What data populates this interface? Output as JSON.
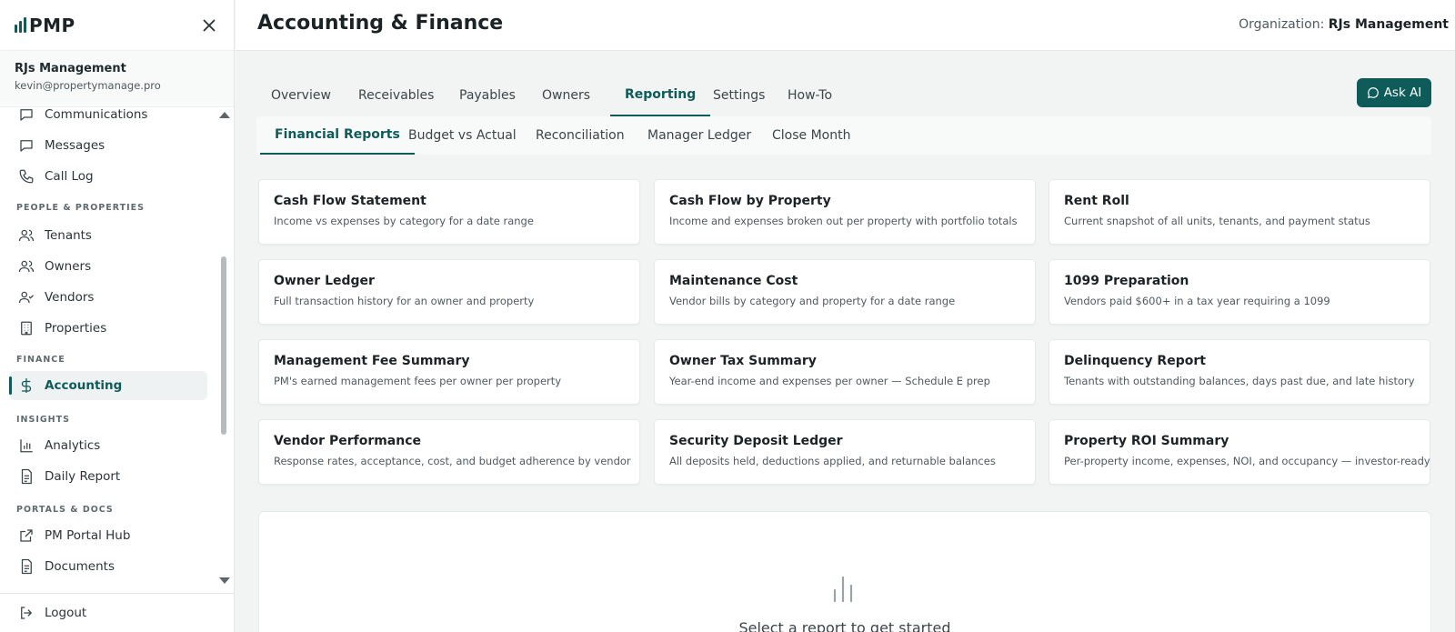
{
  "app": {
    "brand": "PMP",
    "page_title": "Accounting & Finance"
  },
  "org": {
    "label": "Organization:",
    "name": "RJs Management"
  },
  "user": {
    "name": "RJs Management",
    "email": "kevin@propertymanage.pro"
  },
  "sidebar": {
    "items": [
      {
        "label": "Communications",
        "icon": "chat-bubble-icon"
      },
      {
        "label": "Messages",
        "icon": "message-icon"
      },
      {
        "label": "Call Log",
        "icon": "phone-icon"
      },
      {
        "label": "Tenants",
        "icon": "users-icon"
      },
      {
        "label": "Owners",
        "icon": "users-icon"
      },
      {
        "label": "Vendors",
        "icon": "user-check-icon"
      },
      {
        "label": "Properties",
        "icon": "building-icon"
      },
      {
        "label": "Accounting",
        "icon": "dollar-icon"
      },
      {
        "label": "Analytics",
        "icon": "bar-chart-icon"
      },
      {
        "label": "Daily Report",
        "icon": "document-icon"
      },
      {
        "label": "PM Portal Hub",
        "icon": "external-link-icon"
      },
      {
        "label": "Documents",
        "icon": "document-icon"
      }
    ],
    "sections": [
      "PEOPLE & PROPERTIES",
      "FINANCE",
      "INSIGHTS",
      "PORTALS & DOCS"
    ],
    "logout": "Logout"
  },
  "tabs": [
    "Overview",
    "Receivables",
    "Payables",
    "Owners",
    "Reporting",
    "Settings",
    "How-To"
  ],
  "active_tab": "Reporting",
  "ask_ai": "Ask AI",
  "subtabs": [
    "Financial Reports",
    "Budget vs Actual",
    "Reconciliation",
    "Manager Ledger",
    "Close Month"
  ],
  "active_subtab": "Financial Reports",
  "reports": [
    {
      "title": "Cash Flow Statement",
      "desc": "Income vs expenses by category for a date range"
    },
    {
      "title": "Cash Flow by Property",
      "desc": "Income and expenses broken out per property with portfolio totals"
    },
    {
      "title": "Rent Roll",
      "desc": "Current snapshot of all units, tenants, and payment status"
    },
    {
      "title": "Owner Ledger",
      "desc": "Full transaction history for an owner and property"
    },
    {
      "title": "Maintenance Cost",
      "desc": "Vendor bills by category and property for a date range"
    },
    {
      "title": "1099 Preparation",
      "desc": "Vendors paid $600+ in a tax year requiring a 1099"
    },
    {
      "title": "Management Fee Summary",
      "desc": "PM's earned management fees per owner per property"
    },
    {
      "title": "Owner Tax Summary",
      "desc": "Year-end income and expenses per owner — Schedule E prep"
    },
    {
      "title": "Delinquency Report",
      "desc": "Tenants with outstanding balances, days past due, and late history"
    },
    {
      "title": "Vendor Performance",
      "desc": "Response rates, acceptance, cost, and budget adherence by vendor"
    },
    {
      "title": "Security Deposit Ledger",
      "desc": "All deposits held, deductions applied, and returnable balances"
    },
    {
      "title": "Property ROI Summary",
      "desc": "Per-property income, expenses, NOI, and occupancy — investor-ready"
    }
  ],
  "empty_state": {
    "text": "Select a report to get started"
  },
  "colors": {
    "accent": "#0f5b5a",
    "background": "#f2f4f4"
  }
}
